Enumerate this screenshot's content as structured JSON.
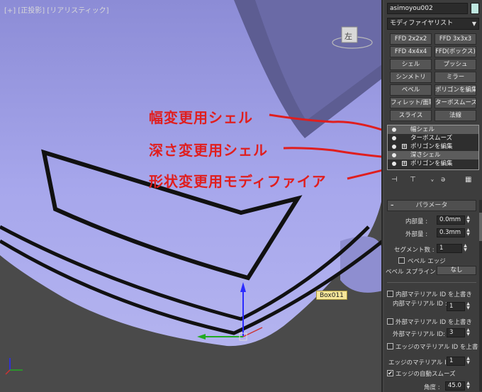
{
  "viewport": {
    "label": "[+] [正投影] [リアリスティック]",
    "object_tag": "Box011",
    "viewcube_face": "左"
  },
  "annotations": {
    "a1": "幅変更用シェル",
    "a2": "深さ変更用シェル",
    "a3": "形状変更用モディファイア"
  },
  "panel": {
    "object_name": "asimoyou002",
    "modifier_list": "モディファイヤリスト",
    "buttons": [
      "FFD 2x2x2",
      "FFD 3x3x3",
      "FFD 4x4x4",
      "FFD(ボックス)",
      "シェル",
      "プッシュ",
      "シンメトリ",
      "ミラー",
      "ベベル",
      "ポリゴンを編集",
      "フィレット/面取り",
      "ターボスムーズ",
      "スライス",
      "法線"
    ],
    "stack": [
      {
        "label": "幅シェル",
        "selected": true,
        "sub": false
      },
      {
        "label": "ターボスムーズ",
        "selected": false,
        "sub": false
      },
      {
        "label": "ポリゴンを編集",
        "selected": false,
        "sub": true
      },
      {
        "label": "深さシェル",
        "selected": true,
        "sub": false
      },
      {
        "label": "ポリゴンを編集",
        "selected": false,
        "sub": true
      }
    ],
    "rollout": {
      "minus": "–",
      "title": "パラメータ",
      "inner_label": "内部量 :",
      "inner_value": "0.0mm",
      "outer_label": "外部量 :",
      "outer_value": "0.3mm",
      "segments_label": "セグメント数 :",
      "segments_value": "1",
      "bevel_edge_label": "ベベル エッジ",
      "bevel_spline_label": "ベベル スプライン :",
      "bevel_spline_value": "なし",
      "override_inner_label": "内部マテリアル ID を上書き",
      "inner_mat_label": "内部マテリアル ID :",
      "inner_mat_value": "1",
      "override_outer_label": "外部マテリアル ID を上書き",
      "outer_mat_label": "外部マテリアル ID:",
      "outer_mat_value": "3",
      "override_edge_label": "エッジのマテリアル ID を上書き",
      "edge_mat_label": "エッジのマテリアル ID :",
      "edge_mat_value": "1",
      "auto_smooth_label": "エッジの自動スムーズ",
      "auto_smooth_check": "✔",
      "angle_label": "角度 :",
      "angle_value": "45.0"
    }
  },
  "colors": {
    "surface": "#9b9bde",
    "surface_dark": "#6e6ea8",
    "annotation_red": "#e01e1e",
    "background": "#4a4a4a"
  }
}
